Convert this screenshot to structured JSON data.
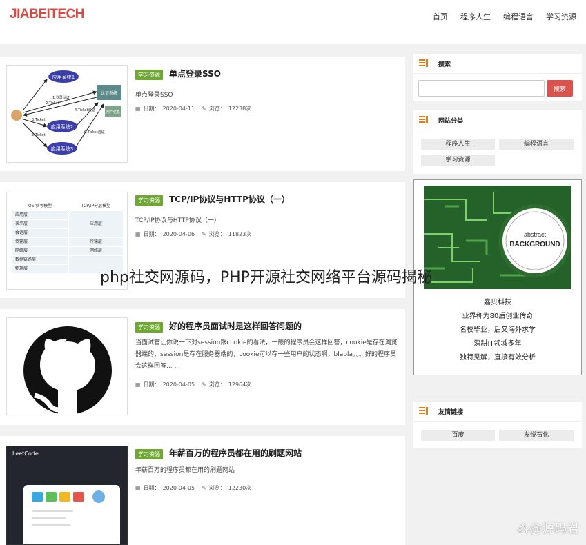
{
  "header": {
    "logo": "JIABEITECH",
    "nav": [
      "首页",
      "程序人生",
      "编程语言",
      "学习资源"
    ]
  },
  "posts": [
    {
      "tag": "学习资源",
      "title": "单点登录SSO",
      "desc": "单点登录SSO",
      "date_label": "日期：",
      "date": "2020-04-11",
      "views_label": "浏览：",
      "views": "12238次",
      "thumb": {
        "nodes": [
          "应用系统1",
          "认证系统",
          "用户信息",
          "应用系统2",
          "应用系统3"
        ],
        "arrows": [
          "1.登录认证",
          "2.Ticket",
          "3.Ticket",
          "4.Ticket验证",
          "5.Ticket",
          "6.Ticket验证"
        ]
      }
    },
    {
      "tag": "学习资源",
      "title": "TCP/IP协议与HTTP协议（一）",
      "desc": "TCP/IP协议与HTTP协议（一）",
      "date_label": "日期：",
      "date": "2020-04-06",
      "views_label": "浏览：",
      "views": "11823次",
      "thumb": {
        "left_head": "OSI参考模型",
        "right_head": "TCP/IP分层模型",
        "left_rows": [
          "应用层",
          "表示层",
          "会话层",
          "传输层",
          "网络层",
          "数据链路层",
          "物理层"
        ],
        "right_rows": [
          "应用层",
          "传输层",
          "网络层"
        ]
      }
    },
    {
      "tag": "学习资源",
      "title": "好的程序员面试时是这样回答问题的",
      "desc": "当面试官让你说一下对session跟cookie的看法，一般的程序员会这样回答，cookie是存在浏览器端的，session是存在服务器端的，cookie可以存一些用户的状态啊，blabla。。。好的程序员会这样回答... ...",
      "date_label": "日期：",
      "date": "2020-04-05",
      "views_label": "浏览：",
      "views": "12964次"
    },
    {
      "tag": "学习资源",
      "title": "年薪百万的程序员都在用的刷题网站",
      "desc": "年薪百万的程序员都在用的刷题网站",
      "date_label": "日期：",
      "date": "2020-04-05",
      "views_label": "浏览：",
      "views": "12230次",
      "thumb": {
        "brand": "LeetCode"
      }
    }
  ],
  "sidebar": {
    "search": {
      "title": "搜索",
      "placeholder": "",
      "button": "搜索"
    },
    "categories": {
      "title": "网站分类",
      "items": [
        "程序人生",
        "编程语言",
        "学习资源"
      ]
    },
    "ad": {
      "img_text_1": "abstract",
      "img_text_2": "BACKGROUND",
      "lines": [
        "嘉贝科技",
        "业界称为80后创业传奇",
        "名校毕业，后又海外求学",
        "深耕IT领域多年",
        "独特见解，直接有效分析"
      ]
    },
    "links": {
      "title": "友情链接",
      "items": [
        "百度",
        "友悦石化"
      ]
    }
  },
  "overlay_caption": "php社交网源码，PHP开源社交网络平台源码揭秘",
  "watermark": "⁂@源码君",
  "colors": {
    "accent_red": "#d64a44",
    "tag_green": "#6ea832",
    "search_btn": "#d9534f",
    "icon_orange": "#e77d1a"
  }
}
